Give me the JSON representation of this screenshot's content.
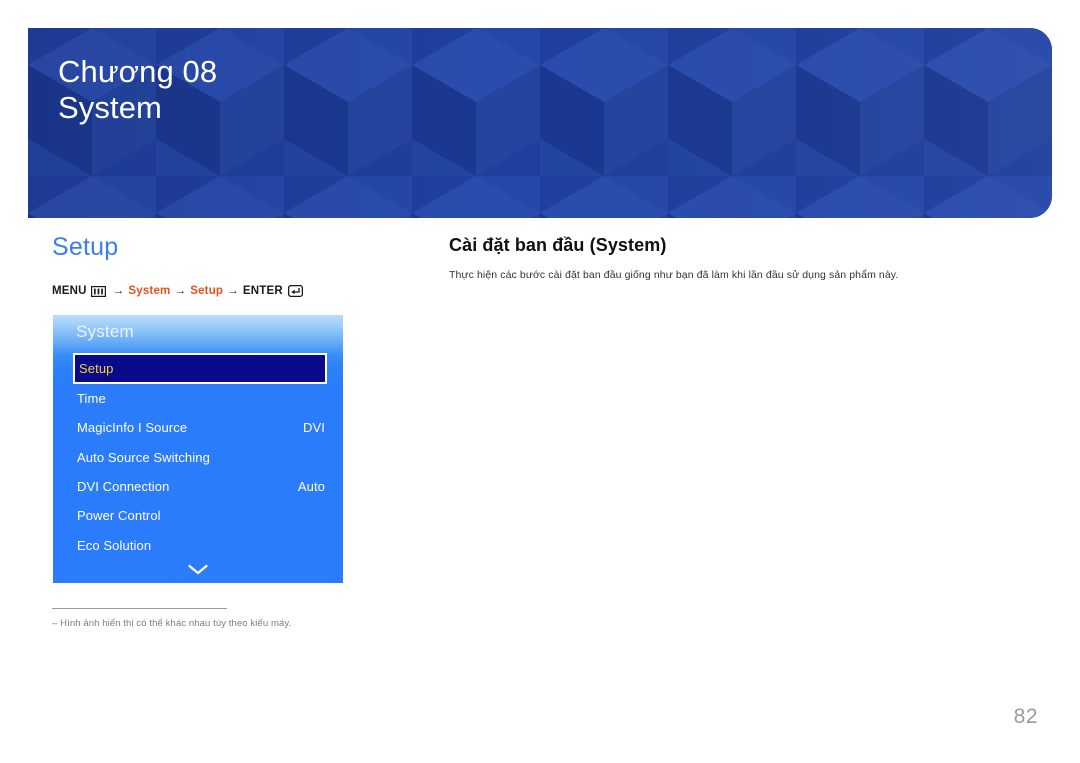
{
  "banner": {
    "chapter": "Chương 08",
    "title": "System",
    "bg_color": "#1f3f9e"
  },
  "section": {
    "heading": "Setup",
    "heading_color": "#3d7eea"
  },
  "breadcrumb": {
    "menu_label": "MENU",
    "menu_icon": "menu-icon",
    "arrow": "→",
    "step1": "System",
    "step2": "Setup",
    "enter_label": "ENTER",
    "enter_icon": "enter-icon",
    "accent_color": "#e8501e"
  },
  "osd": {
    "title": "System",
    "scroll_icon": "chevron-down-icon",
    "selected_text_color": "#f5d433",
    "selected_bg_color": "#0a0a8c",
    "panel_color": "#2a7cfb",
    "rows": [
      {
        "label": "Setup",
        "value": "",
        "selected": true
      },
      {
        "label": "Time",
        "value": "",
        "selected": false
      },
      {
        "label": "MagicInfo I Source",
        "value": "DVI",
        "selected": false
      },
      {
        "label": "Auto Source Switching",
        "value": "",
        "selected": false
      },
      {
        "label": "DVI Connection",
        "value": "Auto",
        "selected": false
      },
      {
        "label": "Power Control",
        "value": "",
        "selected": false
      },
      {
        "label": "Eco Solution",
        "value": "",
        "selected": false
      }
    ]
  },
  "footnote": {
    "text": "‒ Hình ảnh hiển thị có thể khác nhau tùy theo kiểu máy."
  },
  "content": {
    "heading": "Cài đặt ban đầu (System)",
    "paragraph": "Thực hiện các bước cài đặt ban đầu giống như bạn đã làm khi lần đầu sử dụng sản phẩm này."
  },
  "page": {
    "number": "82"
  }
}
